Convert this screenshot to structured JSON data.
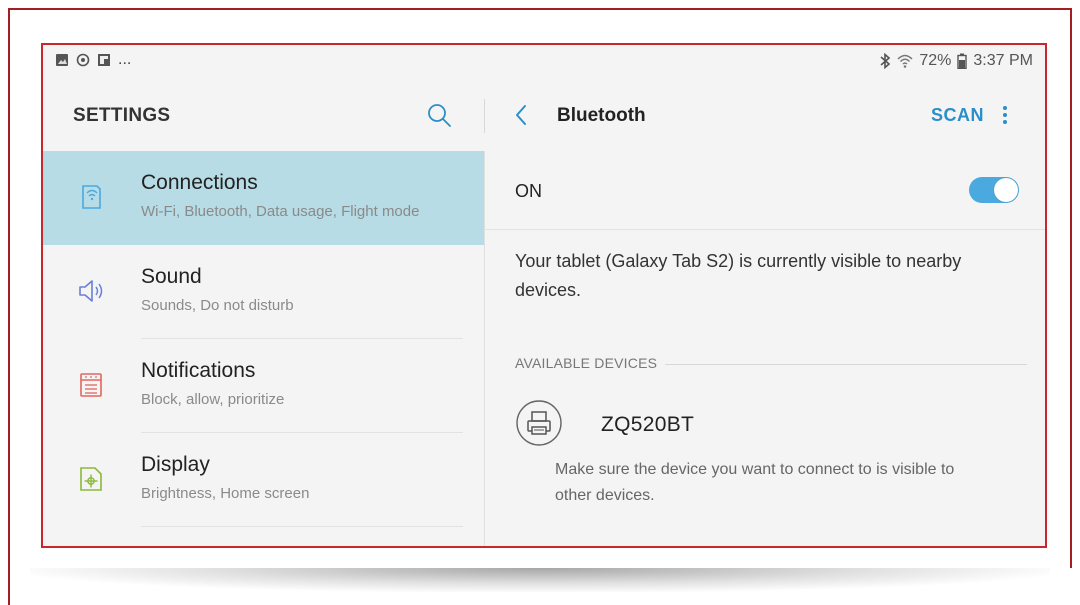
{
  "status_bar": {
    "ellipsis": "...",
    "battery": "72%",
    "time": "3:37 PM"
  },
  "settings": {
    "title": "SETTINGS",
    "items": [
      {
        "title": "Connections",
        "subtitle": "Wi-Fi, Bluetooth, Data usage, Flight mode",
        "icon": "connections-icon",
        "active": true
      },
      {
        "title": "Sound",
        "subtitle": "Sounds, Do not disturb",
        "icon": "speaker-icon",
        "active": false
      },
      {
        "title": "Notifications",
        "subtitle": "Block, allow, prioritize",
        "icon": "notifications-icon",
        "active": false
      },
      {
        "title": "Display",
        "subtitle": "Brightness, Home screen",
        "icon": "display-icon",
        "active": false
      }
    ]
  },
  "bluetooth": {
    "title": "Bluetooth",
    "scan_label": "SCAN",
    "on_label": "ON",
    "toggle_on": true,
    "visible_message": "Your tablet (Galaxy Tab S2) is currently visible to nearby devices.",
    "available_header": "AVAILABLE DEVICES",
    "devices": [
      {
        "name": "ZQ520BT",
        "icon": "printer-icon"
      }
    ],
    "hint": "Make sure the device you want to connect to is visible to other devices."
  },
  "colors": {
    "active_item_bg": "#b7dce6",
    "accent_blue": "#2a8fc9",
    "toggle_blue": "#4aa9de",
    "frame_red": "#a31e22"
  }
}
